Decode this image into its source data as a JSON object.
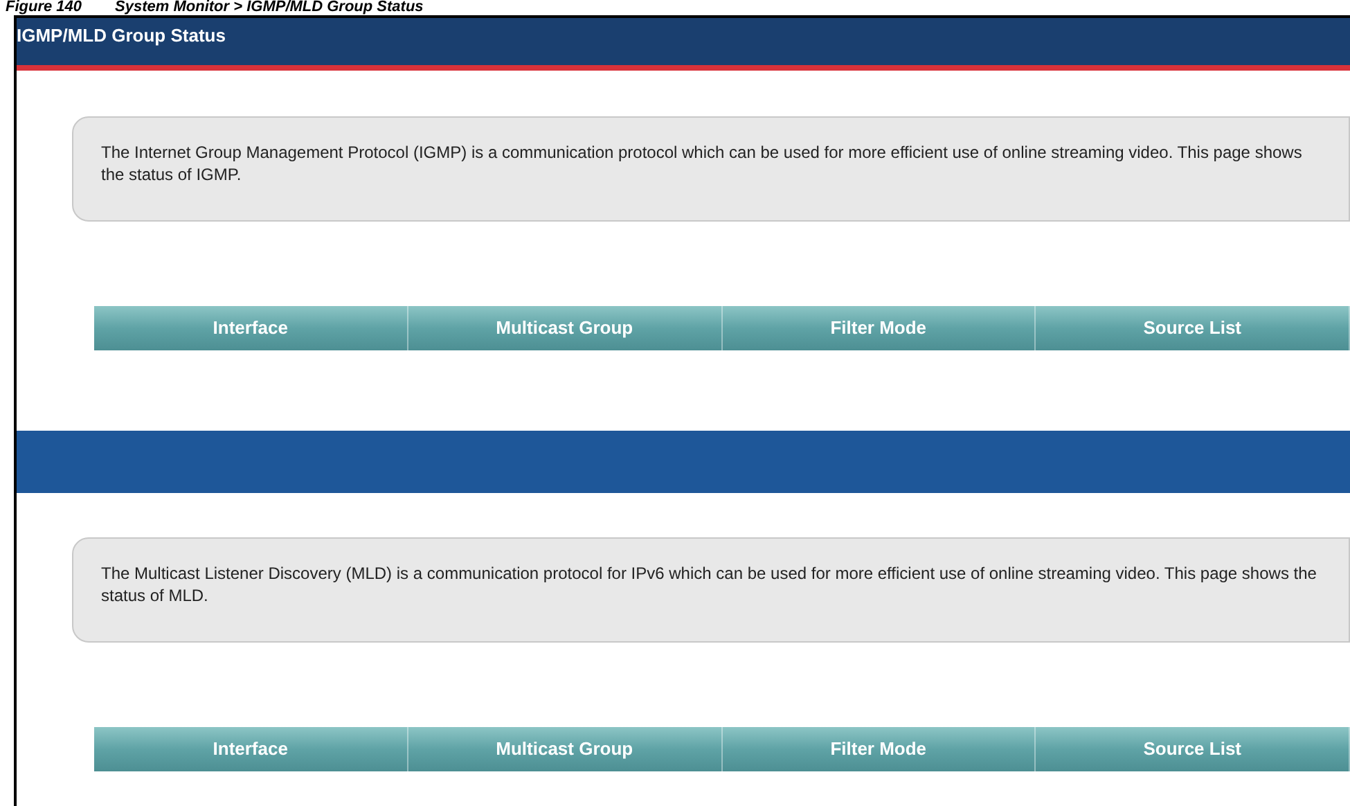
{
  "caption": {
    "figure": "Figure 140",
    "title": "System Monitor > IGMP/MLD Group Status"
  },
  "header": {
    "title": "IGMP/MLD Group Status"
  },
  "sections": [
    {
      "description": "The Internet Group Management Protocol (IGMP) is a communication protocol which can be used for more efficient use of online streaming video. This page shows the status of IGMP.",
      "columns": [
        "Interface",
        "Multicast Group",
        "Filter Mode",
        "Source List"
      ]
    },
    {
      "description": "The Multicast Listener Discovery (MLD) is a communication protocol for IPv6 which can be used for more efficient use of online streaming video. This page shows the status of MLD.",
      "columns": [
        "Interface",
        "Multicast Group",
        "Filter Mode",
        "Source List"
      ]
    }
  ]
}
